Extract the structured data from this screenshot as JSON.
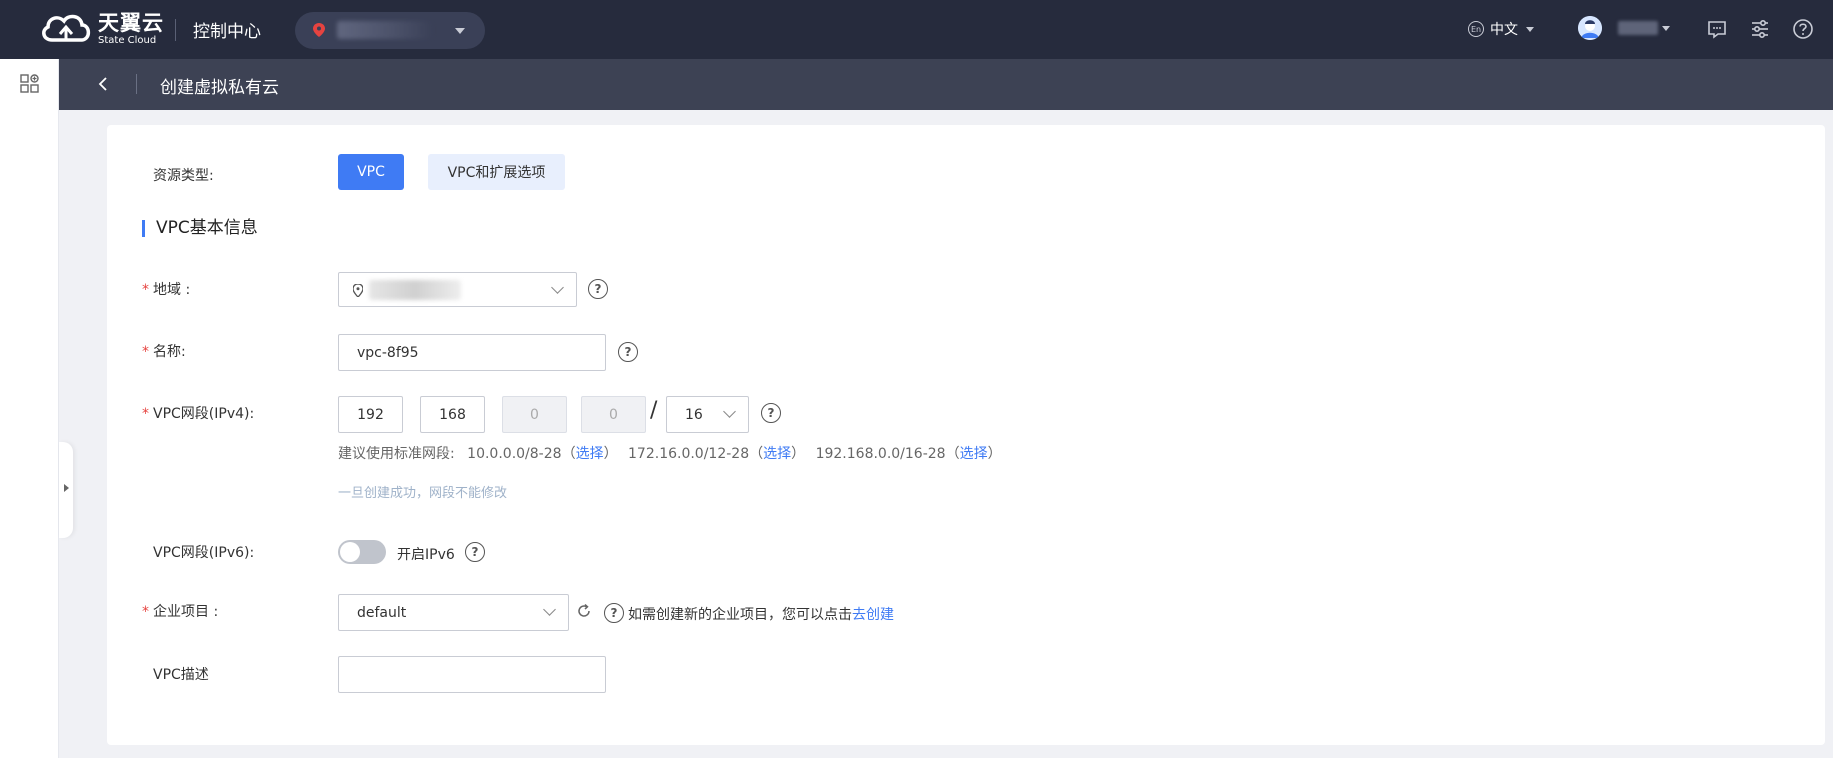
{
  "topbar": {
    "brand_cn": "天翼云",
    "brand_en": "State Cloud",
    "console_title": "控制中心",
    "language": "中文",
    "language_badge": "En"
  },
  "subheader": {
    "page_title": "创建虚拟私有云"
  },
  "form": {
    "resource_type": {
      "label": "资源类型:",
      "options": [
        "VPC",
        "VPC和扩展选项"
      ],
      "selected": "VPC"
    },
    "section_title": "VPC基本信息",
    "required_mark": "*",
    "region": {
      "label": "地域 :"
    },
    "name": {
      "label": "名称:",
      "value": "vpc-8f95"
    },
    "ipv4": {
      "label": "VPC网段(IPv4):",
      "octets": [
        "192",
        "168",
        "0",
        "0"
      ],
      "mask": "16",
      "slash": "/",
      "suggest_prefix": "建议使用标准网段:",
      "suggestions": [
        "10.0.0.0/8-28",
        "172.16.0.0/12-28",
        "192.168.0.0/16-28"
      ],
      "select_label": "选择",
      "notice": "一旦创建成功，网段不能修改"
    },
    "ipv6": {
      "label": "VPC网段(IPv6):",
      "toggle_label": "开启IPv6"
    },
    "enterprise_project": {
      "label": "企业项目 :",
      "value": "default",
      "hint": "如需创建新的企业项目，您可以点击",
      "hint_link": "去创建"
    },
    "description": {
      "label": "VPC描述",
      "value": ""
    }
  },
  "colors": {
    "topbar_bg": "#262b3d",
    "subheader_bg": "#3d4254",
    "primary": "#3f7bf4",
    "required": "#e64340"
  }
}
